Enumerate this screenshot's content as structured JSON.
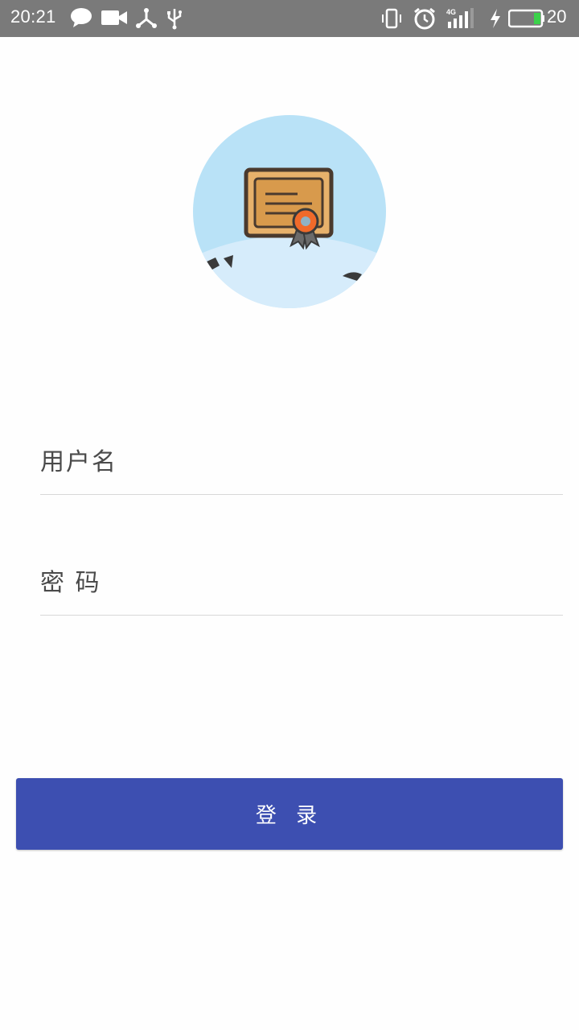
{
  "status_bar": {
    "time": "20:21",
    "battery_percent": "20",
    "icons": [
      "chat-bubble-icon",
      "video-camera-icon",
      "share-icon",
      "usb-icon",
      "vibrate-icon",
      "alarm-icon",
      "signal-4g-icon",
      "charging-icon",
      "battery-icon"
    ]
  },
  "avatar": {
    "icon": "certificate-icon"
  },
  "form": {
    "username_placeholder": "用户名",
    "password_placeholder": "密 码",
    "login_label": "登 录"
  },
  "colors": {
    "status_bar": "#7a7a7a",
    "accent": "#3d4fb1",
    "avatar_bg": "#b9e2f7"
  }
}
